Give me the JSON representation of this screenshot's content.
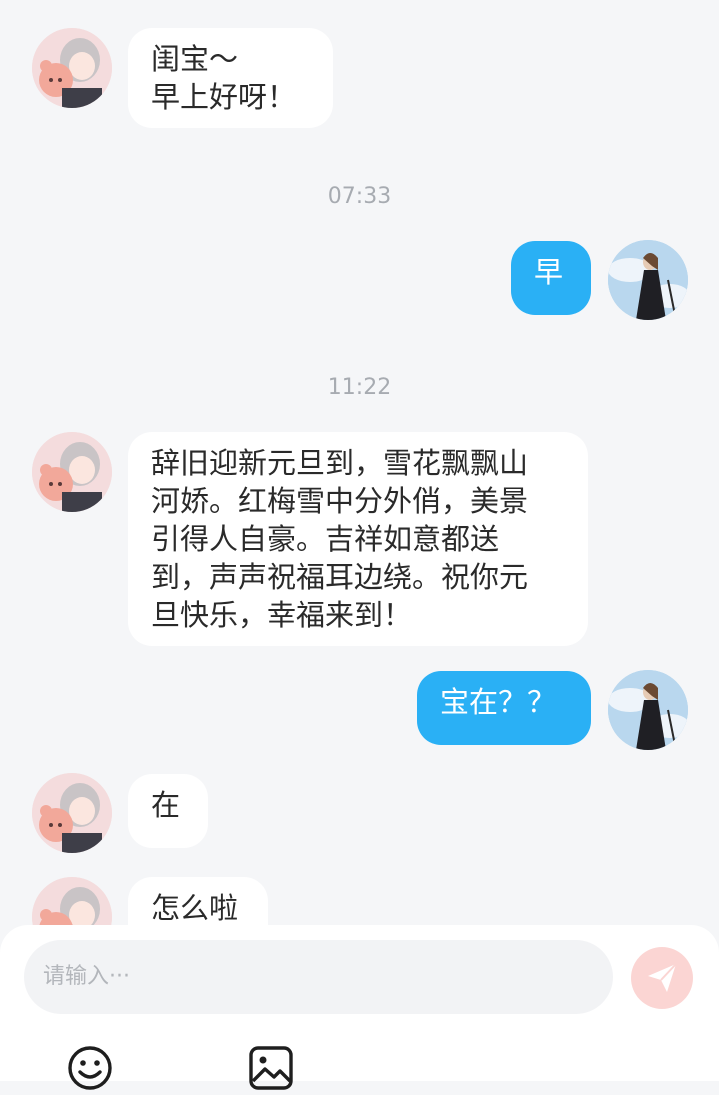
{
  "messages": {
    "m1": "闺宝～\n早上好呀！",
    "m2": "早",
    "m3": "辞旧迎新元旦到，雪花飘飘山\n河娇。红梅雪中分外俏，美景\n引得人自豪。吉祥如意都送\n到，声声祝福耳边绕。祝你元\n旦快乐，幸福来到！",
    "m4": "宝在？？",
    "m5": "在",
    "m6": "怎么啦"
  },
  "timestamps": {
    "t1": "07:33",
    "t2": "11:22"
  },
  "composer": {
    "placeholder": "请输入···"
  },
  "icons": {
    "send": "send-icon",
    "emoji": "emoji-icon",
    "image": "image-icon"
  },
  "colors": {
    "outgoing_bubble": "#2ab0f5",
    "incoming_bubble": "#ffffff",
    "background": "#f5f6f8",
    "send_button": "#fbd5d3",
    "timestamp": "#a7abb1"
  }
}
